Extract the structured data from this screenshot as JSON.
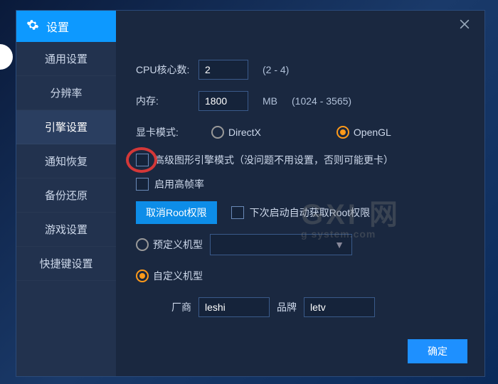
{
  "title": "设置",
  "sidebar": {
    "items": [
      {
        "label": "通用设置"
      },
      {
        "label": "分辨率"
      },
      {
        "label": "引擎设置"
      },
      {
        "label": "通知恢复"
      },
      {
        "label": "备份还原"
      },
      {
        "label": "游戏设置"
      },
      {
        "label": "快捷键设置"
      }
    ],
    "active_index": 2
  },
  "engine": {
    "cpu_label": "CPU核心数:",
    "cpu_value": "2",
    "cpu_range": "(2 - 4)",
    "mem_label": "内存:",
    "mem_value": "1800",
    "mem_unit": "MB",
    "mem_range": "(1024 - 3565)",
    "gpu_label": "显卡模式:",
    "gpu_options": [
      {
        "label": "DirectX",
        "checked": false
      },
      {
        "label": "OpenGL",
        "checked": true
      }
    ],
    "adv_graphics_label": "高级图形引擎模式（没问题不用设置，否则可能更卡）",
    "high_fps_label": "启用高帧率",
    "cancel_root_btn": "取消Root权限",
    "auto_root_label": "下次启动自动获取Root权限",
    "predef_model_label": "预定义机型",
    "custom_model_label": "自定义机型",
    "vendor_label": "厂商",
    "vendor_value": "leshi",
    "brand_label": "品牌",
    "brand_value": "letv"
  },
  "footer": {
    "ok_label": "确定"
  },
  "watermark": {
    "main": "GXI 网",
    "sub": "g system.com"
  }
}
